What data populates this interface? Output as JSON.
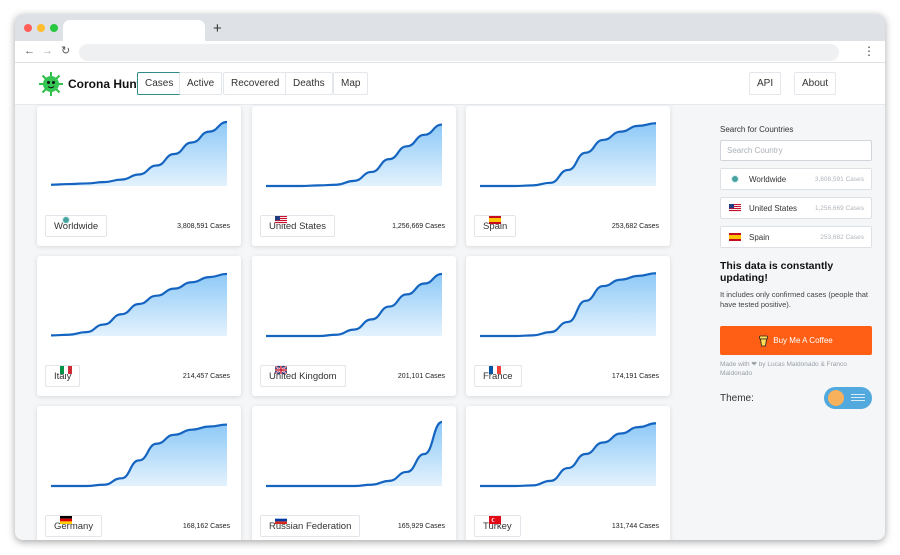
{
  "browser": {
    "new_tab_symbol": "+",
    "menu_symbol": "⋮"
  },
  "header": {
    "brand": "Corona Hunt",
    "tabs": [
      {
        "label": "Cases",
        "active": true
      },
      {
        "label": "Active",
        "active": false
      },
      {
        "label": "Recovered",
        "active": false
      },
      {
        "label": "Deaths",
        "active": false
      },
      {
        "label": "Map",
        "active": false
      }
    ],
    "right_buttons": [
      {
        "label": "API"
      },
      {
        "label": "About"
      }
    ]
  },
  "cards": [
    {
      "country": "Worldwide",
      "cases": "3,808,591 Cases",
      "flag": "world",
      "curve": [
        0.02,
        0.03,
        0.04,
        0.06,
        0.1,
        0.18,
        0.32,
        0.5,
        0.68,
        0.85,
        1.0
      ]
    },
    {
      "country": "United States",
      "cases": "1,256,669 Cases",
      "flag": "us",
      "curve": [
        0,
        0,
        0,
        0.01,
        0.02,
        0.08,
        0.22,
        0.42,
        0.62,
        0.8,
        0.96
      ]
    },
    {
      "country": "Spain",
      "cases": "253,682 Cases",
      "flag": "es",
      "curve": [
        0,
        0,
        0,
        0.01,
        0.05,
        0.25,
        0.52,
        0.72,
        0.85,
        0.94,
        0.98
      ]
    },
    {
      "country": "Italy",
      "cases": "214,457 Cases",
      "flag": "it",
      "curve": [
        0.01,
        0.02,
        0.06,
        0.18,
        0.34,
        0.5,
        0.63,
        0.74,
        0.84,
        0.92,
        0.97
      ]
    },
    {
      "country": "United Kingdom",
      "cases": "201,101 Cases",
      "flag": "gb",
      "curve": [
        0,
        0,
        0,
        0,
        0.02,
        0.1,
        0.26,
        0.46,
        0.65,
        0.82,
        0.97
      ]
    },
    {
      "country": "France",
      "cases": "174,191 Cases",
      "flag": "fr",
      "curve": [
        0,
        0,
        0,
        0.01,
        0.06,
        0.22,
        0.55,
        0.78,
        0.88,
        0.94,
        0.98
      ]
    },
    {
      "country": "Germany",
      "cases": "168,162 Cases",
      "flag": "de",
      "curve": [
        0,
        0,
        0,
        0.02,
        0.12,
        0.4,
        0.66,
        0.8,
        0.88,
        0.93,
        0.96
      ]
    },
    {
      "country": "Russian Federation",
      "cases": "165,929 Cases",
      "flag": "ru",
      "curve": [
        0,
        0,
        0,
        0,
        0,
        0,
        0.02,
        0.08,
        0.22,
        0.5,
        1.0
      ]
    },
    {
      "country": "Turkey",
      "cases": "131,744 Cases",
      "flag": "tr",
      "curve": [
        0,
        0,
        0,
        0.01,
        0.08,
        0.28,
        0.5,
        0.68,
        0.82,
        0.92,
        0.98
      ]
    }
  ],
  "sidebar": {
    "search_label": "Search for Countries",
    "search_placeholder": "Search Country",
    "items": [
      {
        "name": "Worldwide",
        "cases": "3,808,591 Cases",
        "flag": "world"
      },
      {
        "name": "United States",
        "cases": "1,256,669 Cases",
        "flag": "us"
      },
      {
        "name": "Spain",
        "cases": "253,682 Cases",
        "flag": "es"
      }
    ],
    "heading": "This data is constantly updating!",
    "text": "It includes only confirmed cases (people that have tested positive).",
    "coffee_button": "Buy Me A Coffee",
    "made_with": "Made with ❤ by Lucas Maldonado & Franco Maldonado",
    "theme_label": "Theme:",
    "theme_dark": false
  },
  "colors": {
    "curve": "#1565c0",
    "fill_top": "#8ec9f7",
    "fill_bottom": "#e3f2fd",
    "coffee": "#ff5f15",
    "accent": "#2e8b86"
  }
}
